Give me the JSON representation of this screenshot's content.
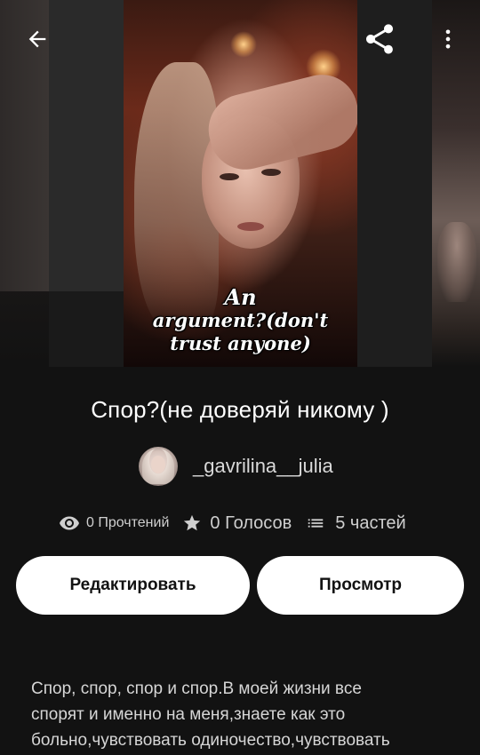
{
  "cover": {
    "text_line1": "An",
    "text_line2": "argument?(don't",
    "text_line3": "trust anyone)"
  },
  "header": {
    "back_icon": "arrow-left-icon",
    "share_icon": "share-icon",
    "more_icon": "more-vertical-icon"
  },
  "story": {
    "title": "Спор?(не доверяй никому )",
    "author": "_gavrilina__julia"
  },
  "stats": {
    "reads": "0 Прочтений",
    "votes": "0 Голосов",
    "parts": "5 частей"
  },
  "actions": {
    "edit_label": "Редактировать",
    "view_label": "Просмотр"
  },
  "description": {
    "line1": "Спор, спор, спор и спор.В моей жизни все",
    "line2": "спорят и именно на меня,знаете как это",
    "line3": "больно,чувствовать одиночество,чувствовать"
  },
  "colors": {
    "background": "#121212",
    "button_bg": "#ffffff",
    "button_text": "#121212",
    "text_primary": "#ffffff",
    "text_secondary": "#d6d6d6"
  }
}
